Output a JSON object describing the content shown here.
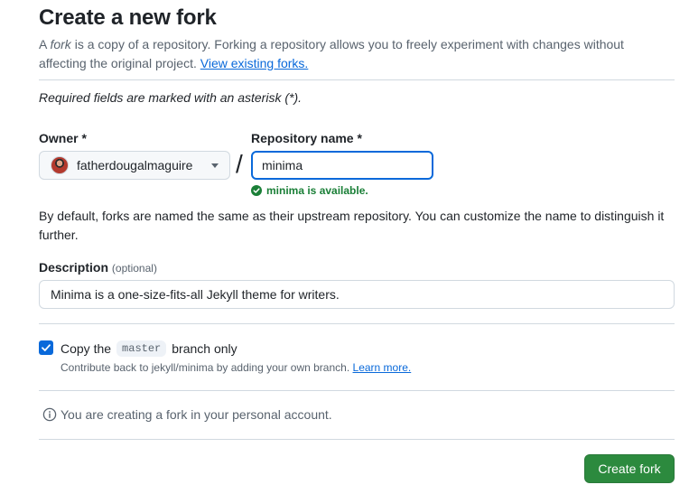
{
  "page": {
    "title": "Create a new fork",
    "intro_before": "A ",
    "intro_em": "fork",
    "intro_after": " is a copy of a repository. Forking a repository allows you to freely experiment with changes without affecting the original project. ",
    "intro_link": "View existing forks.",
    "required_note": "Required fields are marked with an asterisk (*)."
  },
  "owner": {
    "label": "Owner *",
    "value": "fatherdougalmaguire",
    "icon": "chevron-down-icon"
  },
  "separator": "/",
  "repository": {
    "label": "Repository name *",
    "value": "minima",
    "availability": "minima is available.",
    "status_color": "#1a7f37"
  },
  "help_text": "By default, forks are named the same as their upstream repository. You can customize the name to distinguish it further.",
  "description": {
    "label": "Description",
    "optional": "(optional)",
    "value": "Minima is a one-size-fits-all Jekyll theme for writers."
  },
  "copy_branch": {
    "checked": true,
    "label_before": "Copy the",
    "branch": "master",
    "label_after": "branch only",
    "note": "Contribute back to jekyll/minima by adding your own branch.",
    "note_link": "Learn more."
  },
  "info": {
    "icon": "info-icon",
    "text": "You are creating a fork in your personal account."
  },
  "actions": {
    "create_label": "Create fork",
    "accent": "#2c8a3e"
  }
}
